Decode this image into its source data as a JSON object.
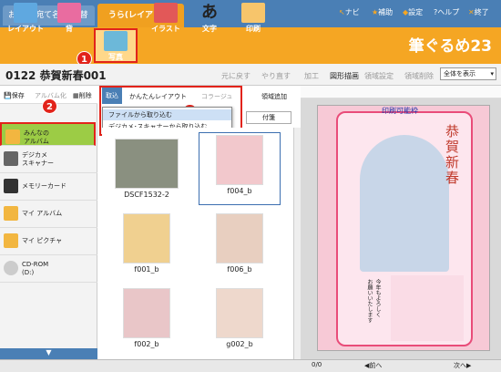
{
  "tabs": {
    "front": "おもて(宛て名)へ切替",
    "back": "うら(レイアウト)"
  },
  "menu": {
    "navi": "ナビ",
    "help": "補助",
    "settings": "設定",
    "question": "?ヘルプ",
    "exit": "終了"
  },
  "toolbar": {
    "layout": "レイアウト",
    "background": "背",
    "photo": "写真",
    "illust": "イラスト",
    "text": "文字",
    "print": "印刷"
  },
  "brand": "筆ぐるめ23",
  "badges": [
    "1",
    "2",
    "3"
  ],
  "doc": {
    "title": "0122  恭賀新春001",
    "undo": "元に戻す",
    "redo": "やり直す"
  },
  "actions": {
    "save": "保存",
    "album": "アルバム化",
    "delete": "削除"
  },
  "pictabs": {
    "import": "取込",
    "easy_layout": "かんたんレイアウト",
    "collage": "コラージュ",
    "add_area": "領域追加",
    "sort_label": "付箋"
  },
  "dropdown": [
    "ファイルから取り込む",
    "デジカメ･スキャナーから取り込む"
  ],
  "nav": [
    {
      "label": "みんなの\nアルバム"
    },
    {
      "label": "デジカメ\nスキャナー"
    },
    {
      "label": "メモリーカード"
    },
    {
      "label": "マイ アルバム"
    },
    {
      "label": "マイ ピクチャ"
    },
    {
      "label": "CD-ROM\n(D:)"
    }
  ],
  "thumbs": [
    "DSCF1532-2",
    "f004_b",
    "f001_b",
    "f006_b",
    "f002_b",
    "g002_b"
  ],
  "right": {
    "processing": "加工",
    "shape": "図形描画",
    "area_settings": "領域設定",
    "area_delete": "領域削除",
    "view": "全体を表示",
    "printable": "印刷可能枠",
    "greeting": "恭賀新春",
    "message": "今年もよろしく\nお願いいたします"
  },
  "bottom": {
    "page": "0/0",
    "prev": "前へ",
    "next": "次へ"
  },
  "colors": {
    "orange": "#f5a623",
    "red": "#e2231a",
    "blue": "#4a7fb5",
    "green": "#76b82a"
  }
}
